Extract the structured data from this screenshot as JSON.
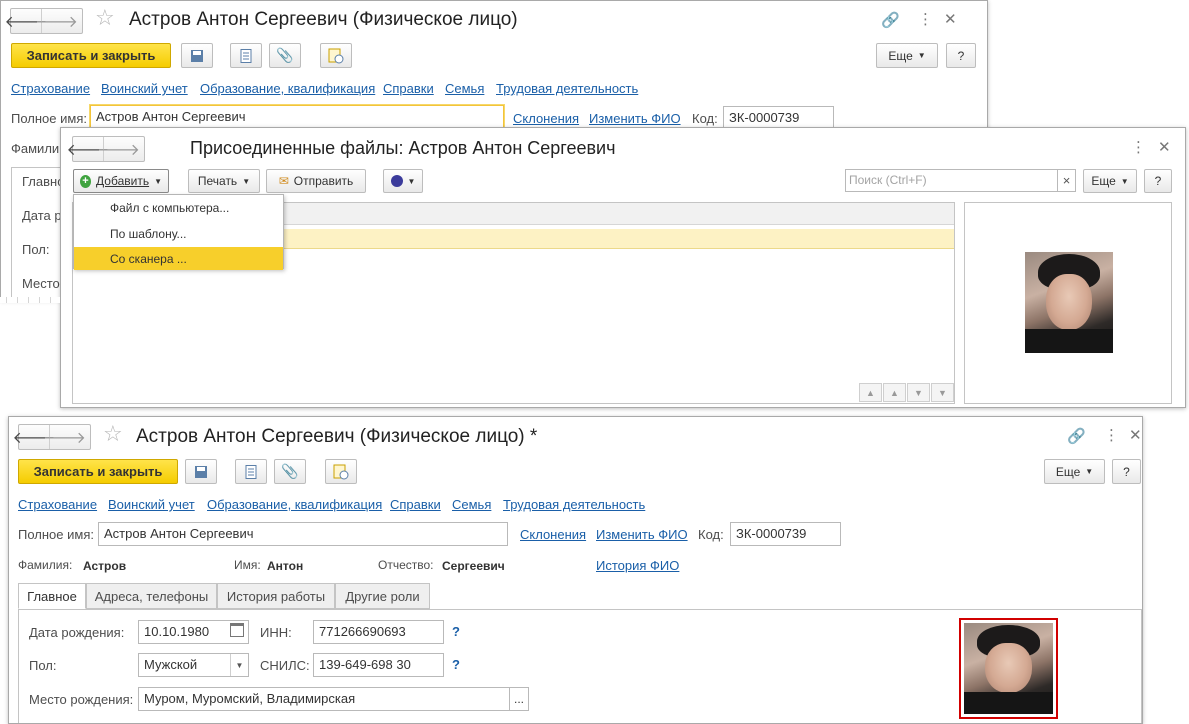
{
  "back_form": {
    "title": "Астров Антон Сергеевич (Физическое лицо)",
    "save_close": "Записать и закрыть",
    "more": "Еще",
    "help": "?",
    "links": [
      "Страхование",
      "Воинский учет",
      "Образование, квалификация",
      "Справки",
      "Семья",
      "Трудовая деятельность"
    ],
    "full_name_label": "Полное имя:",
    "full_name_value": "Астров Антон Сергеевич",
    "declensions": "Склонения",
    "change_fio": "Изменить ФИО",
    "code_label": "Код:",
    "code_value": "ЗК-0000739",
    "partial_labels": [
      "Фамили",
      "Главно",
      "Дата р",
      "Пол:",
      "Место"
    ]
  },
  "files_dialog": {
    "title": "Присоединенные файлы: Астров Антон Сергеевич",
    "add": "Добавить",
    "print": "Печать",
    "send": "Отправить",
    "search_placeholder": "Поиск (Ctrl+F)",
    "search_clear": "×",
    "more": "Еще",
    "help": "?",
    "menu": [
      "Файл с компьютера...",
      "По шаблону...",
      "Со сканера ..."
    ],
    "selected_menu_index": 2
  },
  "front_form": {
    "title": "Астров Антон Сергеевич (Физическое лицо) *",
    "save_close": "Записать и закрыть",
    "more": "Еще",
    "help": "?",
    "links": [
      "Страхование",
      "Воинский учет",
      "Образование, квалификация",
      "Справки",
      "Семья",
      "Трудовая деятельность"
    ],
    "full_name_label": "Полное имя:",
    "full_name_value": "Астров Антон Сергеевич",
    "declensions": "Склонения",
    "change_fio": "Изменить ФИО",
    "code_label": "Код:",
    "code_value": "ЗК-0000739",
    "last_name_label": "Фамилия:",
    "last_name": "Астров",
    "first_name_label": "Имя:",
    "first_name": "Антон",
    "middle_name_label": "Отчество:",
    "middle_name": "Сергеевич",
    "fio_history": "История ФИО",
    "tabs": [
      "Главное",
      "Адреса, телефоны",
      "История работы",
      "Другие роли"
    ],
    "birth_date_label": "Дата рождения:",
    "birth_date": "10.10.1980",
    "inn_label": "ИНН:",
    "inn": "771266690693",
    "gender_label": "Пол:",
    "gender": "Мужской",
    "snils_label": "СНИЛС:",
    "snils": "139-649-698 30",
    "birth_place_label": "Место рождения:",
    "birth_place": "Муром, Муромский, Владимирская",
    "ellipsis": "...",
    "help_q": "?"
  },
  "colors": {
    "accent_yellow": "#f5cc00",
    "link": "#1a5fa8",
    "selected_row": "#fdf2c4",
    "photo_border": "#d10000"
  }
}
